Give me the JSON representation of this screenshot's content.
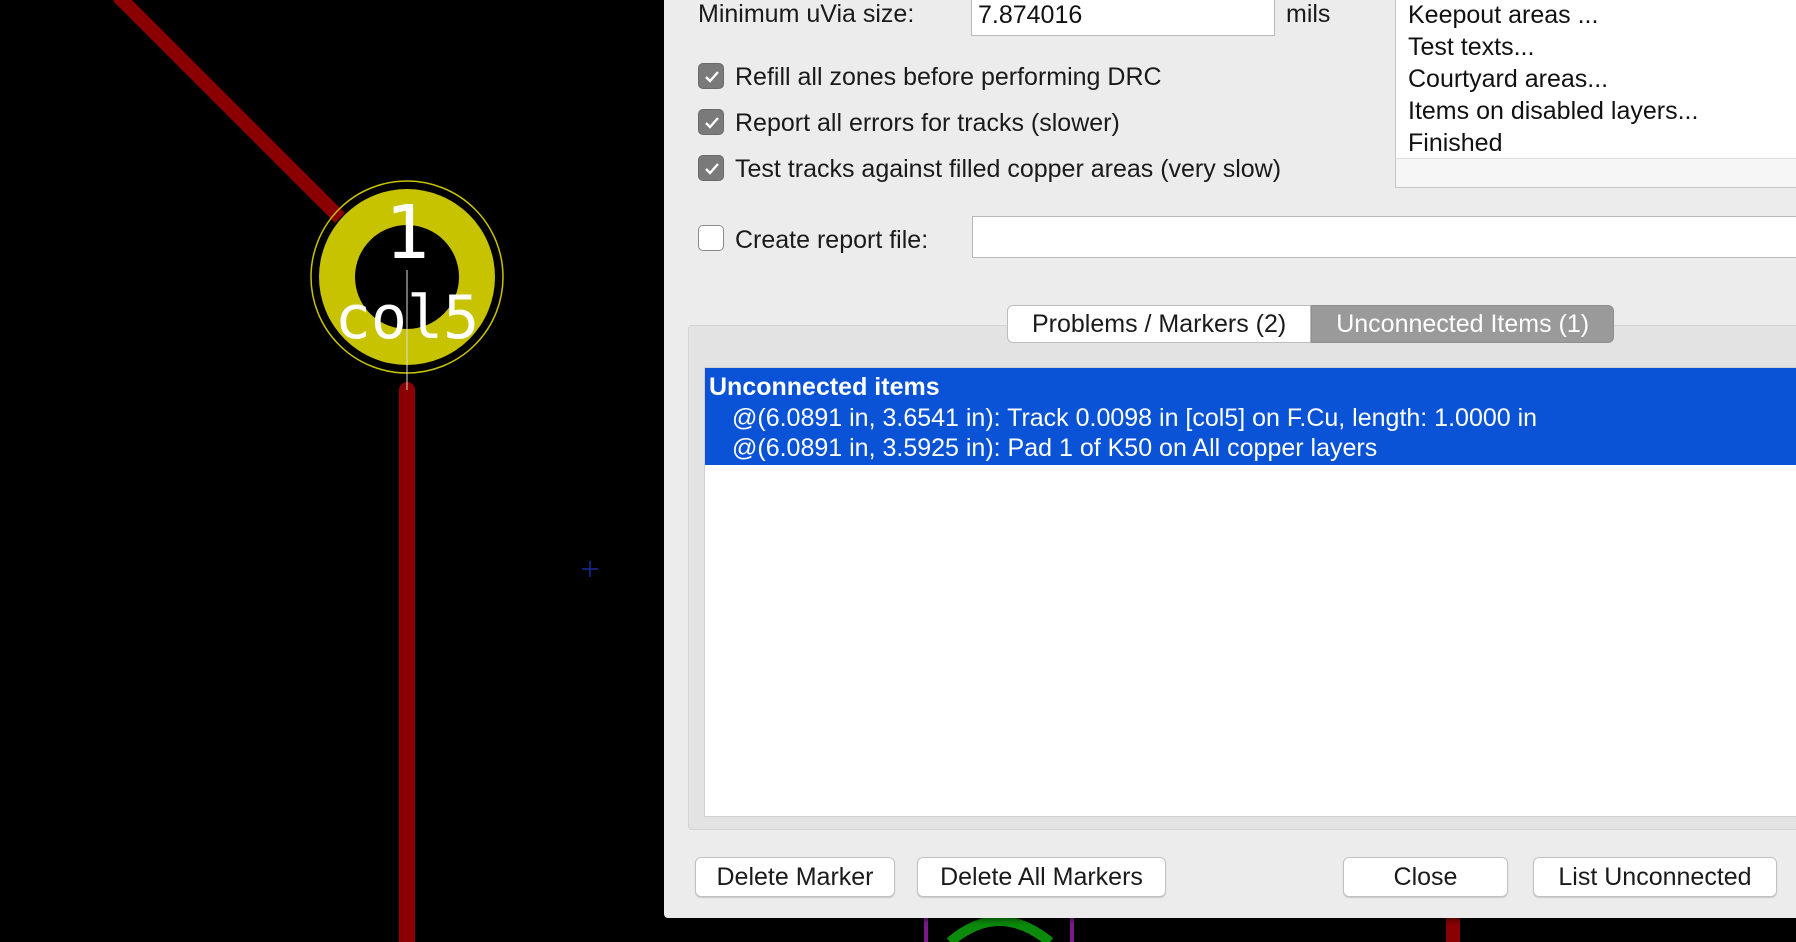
{
  "pcb": {
    "pad_number": "1",
    "pad_net": "col5",
    "colors": {
      "track": "#8b0000",
      "pad": "#c8c300",
      "pad_text": "#ffffff",
      "other_footprint": "#0b8a0b",
      "other_outline": "#7a1a8a"
    }
  },
  "dialog": {
    "min_uvia_label": "Minimum uVia size:",
    "min_uvia_value": "7.874016",
    "min_uvia_unit": "mils",
    "options": [
      {
        "label": "Refill all zones before performing DRC",
        "checked": true
      },
      {
        "label": "Report all errors for tracks (slower)",
        "checked": true
      },
      {
        "label": "Test tracks against filled copper areas (very slow)",
        "checked": true
      }
    ],
    "report_file": {
      "label": "Create report file:",
      "checked": false,
      "value": ""
    },
    "test_log": [
      "Keepout areas ...",
      "Test texts...",
      "Courtyard areas...",
      "Items on disabled layers...",
      "Finished"
    ],
    "tabs": [
      {
        "label": "Problems / Markers (2)",
        "active": false
      },
      {
        "label": "Unconnected Items (1)",
        "active": true
      }
    ],
    "unconnected": {
      "header": "Unconnected items",
      "rows": [
        "@(6.0891 in, 3.6541 in): Track 0.0098 in [col5] on F.Cu, length: 1.0000 in",
        "@(6.0891 in, 3.5925 in): Pad 1 of K50 on All copper layers"
      ]
    },
    "buttons": {
      "delete_marker": "Delete Marker",
      "delete_all_markers": "Delete All Markers",
      "close": "Close",
      "list_unconnected": "List Unconnected"
    },
    "colors": {
      "selection": "#0a53d6",
      "active_tab": "#9a9a9a",
      "background": "#ececec"
    }
  }
}
